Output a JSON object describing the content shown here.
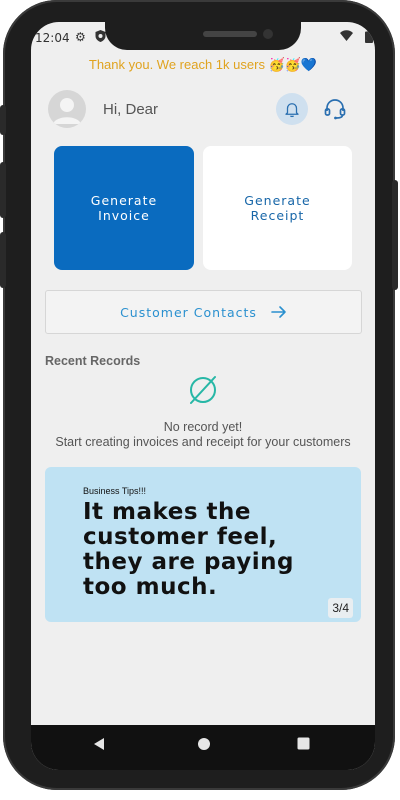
{
  "status": {
    "time": "12:04"
  },
  "banner": {
    "text": "Thank you.  We reach 1k users 🥳🥳💙"
  },
  "header": {
    "greeting": "Hi, Dear"
  },
  "actions": {
    "invoice_label": "Generate\nInvoice",
    "receipt_label": "Generate\nReceipt"
  },
  "contacts": {
    "label": "Customer Contacts"
  },
  "recent": {
    "title": "Recent Records",
    "empty_title": "No record yet!",
    "empty_subtitle": "Start creating invoices and receipt for your customers"
  },
  "tip": {
    "label": "Business Tips!!!",
    "quote": "It makes the\ncustomer feel,\nthey are paying\ntoo much.",
    "page": "3/4"
  },
  "colors": {
    "primary": "#0a6bbf",
    "accent": "#2a90cf",
    "banner": "#e0a31f",
    "tip_bg": "#bfe2f3",
    "empty_icon": "#27b7a6"
  },
  "icons": {
    "status": [
      "gear-icon",
      "shield-icon",
      "wifi-icon",
      "battery-icon"
    ],
    "header": [
      "avatar-icon",
      "bell-icon",
      "headset-icon"
    ],
    "contacts": "arrow-right-icon",
    "empty": "empty-set-icon",
    "nav": [
      "back-icon",
      "home-icon",
      "recents-icon"
    ]
  }
}
